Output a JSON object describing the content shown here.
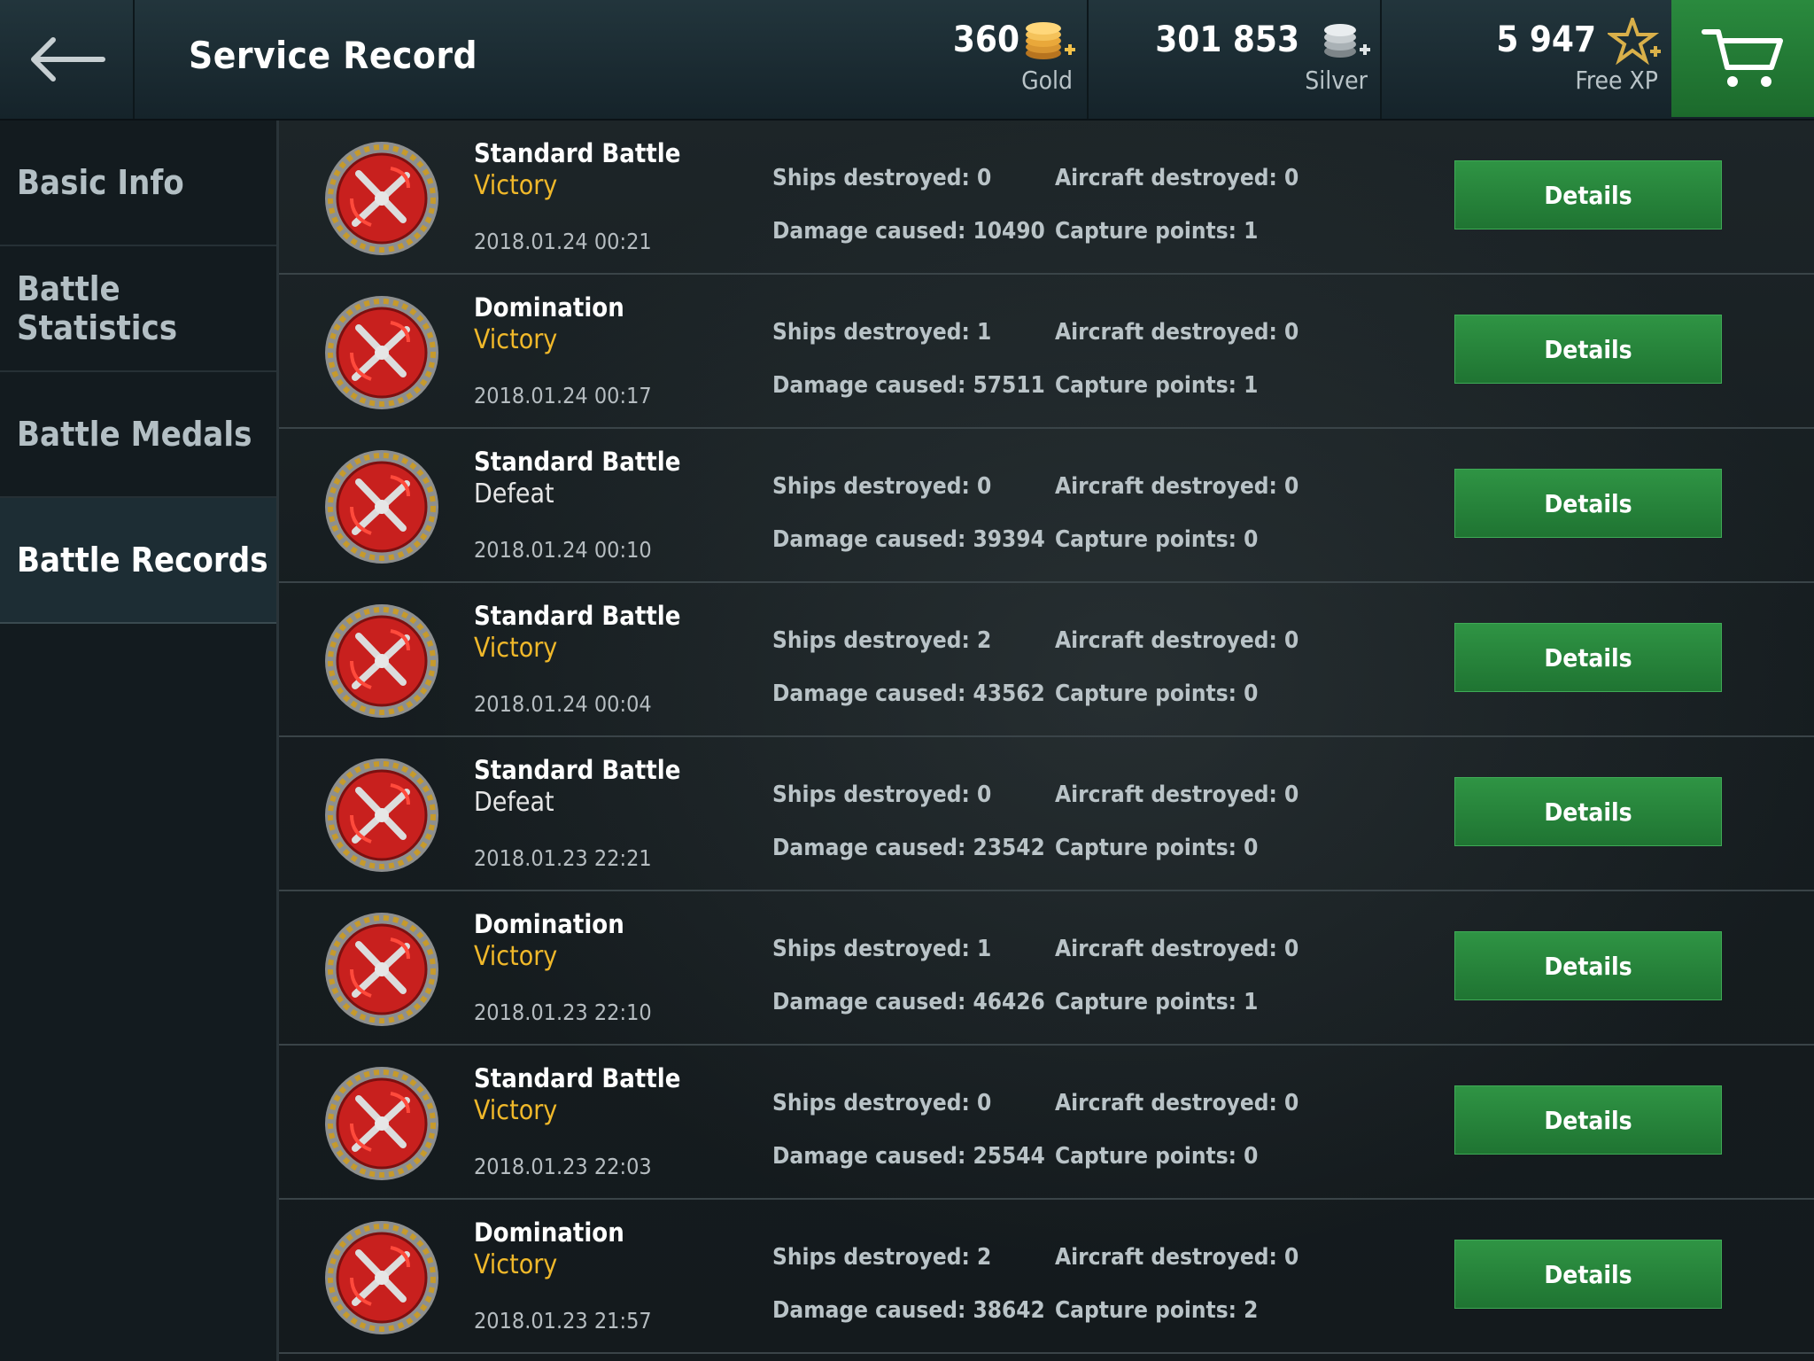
{
  "header": {
    "title": "Service Record",
    "currencies": [
      {
        "value": "360",
        "label": "Gold",
        "icon": "gold-coins-icon"
      },
      {
        "value": "301 853",
        "label": "Silver",
        "icon": "silver-coins-icon"
      },
      {
        "value": "5 947",
        "label": "Free XP",
        "icon": "star-icon"
      }
    ]
  },
  "sidebar": {
    "items": [
      {
        "label": "Basic Info",
        "active": false
      },
      {
        "label": "Battle Statistics",
        "active": false
      },
      {
        "label": "Battle Medals",
        "active": false
      },
      {
        "label": "Battle Records",
        "active": true
      }
    ]
  },
  "records": [
    {
      "type": "Standard Battle",
      "result": "Victory",
      "date": "2018.01.24 00:21",
      "ships": "Ships destroyed: 0",
      "aircraft": "Aircraft destroyed: 0",
      "damage": "Damage caused: 10490",
      "capture": "Capture points: 1",
      "button": "Details"
    },
    {
      "type": "Domination",
      "result": "Victory",
      "date": "2018.01.24 00:17",
      "ships": "Ships destroyed: 1",
      "aircraft": "Aircraft destroyed: 0",
      "damage": "Damage caused: 57511",
      "capture": "Capture points: 1",
      "button": "Details"
    },
    {
      "type": "Standard Battle",
      "result": "Defeat",
      "date": "2018.01.24 00:10",
      "ships": "Ships destroyed: 0",
      "aircraft": "Aircraft destroyed: 0",
      "damage": "Damage caused: 39394",
      "capture": "Capture points: 0",
      "button": "Details"
    },
    {
      "type": "Standard Battle",
      "result": "Victory",
      "date": "2018.01.24 00:04",
      "ships": "Ships destroyed: 2",
      "aircraft": "Aircraft destroyed: 0",
      "damage": "Damage caused: 43562",
      "capture": "Capture points: 0",
      "button": "Details"
    },
    {
      "type": "Standard Battle",
      "result": "Defeat",
      "date": "2018.01.23 22:21",
      "ships": "Ships destroyed: 0",
      "aircraft": "Aircraft destroyed: 0",
      "damage": "Damage caused: 23542",
      "capture": "Capture points: 0",
      "button": "Details"
    },
    {
      "type": "Domination",
      "result": "Victory",
      "date": "2018.01.23 22:10",
      "ships": "Ships destroyed: 1",
      "aircraft": "Aircraft destroyed: 0",
      "damage": "Damage caused: 46426",
      "capture": "Capture points: 1",
      "button": "Details"
    },
    {
      "type": "Standard Battle",
      "result": "Victory",
      "date": "2018.01.23 22:03",
      "ships": "Ships destroyed: 0",
      "aircraft": "Aircraft destroyed: 0",
      "damage": "Damage caused: 25544",
      "capture": "Capture points: 0",
      "button": "Details"
    },
    {
      "type": "Domination",
      "result": "Victory",
      "date": "2018.01.23 21:57",
      "ships": "Ships destroyed: 2",
      "aircraft": "Aircraft destroyed: 0",
      "damage": "Damage caused: 38642",
      "capture": "Capture points: 2",
      "button": "Details"
    }
  ],
  "colors": {
    "victory": "#f0b82a",
    "defeat": "#e6e6e6",
    "button_green": "#2a8a3e"
  }
}
